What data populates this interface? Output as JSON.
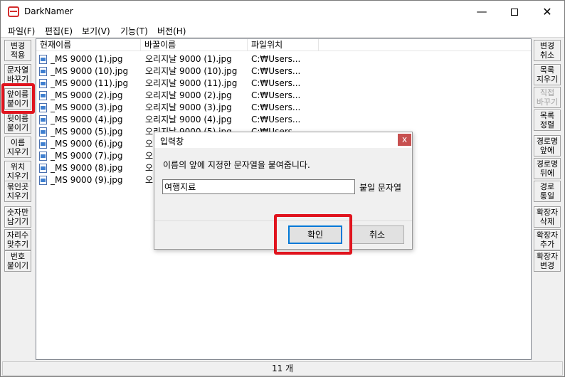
{
  "window": {
    "title": "DarkNamer",
    "min_glyph": "—",
    "close_glyph": "✕"
  },
  "menu": [
    "파일(F)",
    "편집(E)",
    "보기(V)",
    "기능(T)",
    "버전(H)"
  ],
  "left_buttons": [
    "변경\n적용",
    "문자열\n바꾸기",
    "앞이름\n붙이기",
    "뒷이름\n붙이기",
    "이름\n지우기",
    "위치\n지우기",
    "묶인곳\n지우기",
    "숫자만\n남기기",
    "자리수\n맞추기",
    "번호\n붙이기"
  ],
  "right_buttons": [
    "변경\n취소",
    "목록\n지우기",
    "직접\n바꾸기",
    "목록\n정렬",
    "경로명\n앞에",
    "경로명\n뒤에",
    "경로\n통일",
    "확장자\n삭제",
    "확장자\n추가",
    "확장자\n변경"
  ],
  "list": {
    "columns": [
      "현재이름",
      "바꿀이름",
      "파일위치"
    ],
    "rows": [
      [
        "_MS 9000 (1).jpg",
        "오리지날 9000 (1).jpg",
        "C:₩Users..."
      ],
      [
        "_MS 9000 (10).jpg",
        "오리지날 9000 (10).jpg",
        "C:₩Users..."
      ],
      [
        "_MS 9000 (11).jpg",
        "오리지날 9000 (11).jpg",
        "C:₩Users..."
      ],
      [
        "_MS 9000 (2).jpg",
        "오리지날 9000 (2).jpg",
        "C:₩Users..."
      ],
      [
        "_MS 9000 (3).jpg",
        "오리지날 9000 (3).jpg",
        "C:₩Users..."
      ],
      [
        "_MS 9000 (4).jpg",
        "오리지날 9000 (4).jpg",
        "C:₩Users..."
      ],
      [
        "_MS 9000 (5).jpg",
        "오리지날 9000 (5).jpg",
        "C:₩Users..."
      ],
      [
        "_MS 9000 (6).jpg",
        "오",
        ""
      ],
      [
        "_MS 9000 (7).jpg",
        "오",
        ""
      ],
      [
        "_MS 9000 (8).jpg",
        "오",
        ""
      ],
      [
        "_MS 9000 (9).jpg",
        "오",
        ""
      ]
    ]
  },
  "status": "11 개",
  "dialog": {
    "title": "입력창",
    "close_glyph": "x",
    "message": "이름의 앞에 지정한 문자열을 붙여줍니다.",
    "input_value": "여행지료",
    "input_label": "붙일 문자열",
    "ok_label": "확인",
    "cancel_label": "취소"
  },
  "colors": {
    "highlight": "#e0141e",
    "accent": "#0078d7",
    "close_red": "#c75050"
  }
}
